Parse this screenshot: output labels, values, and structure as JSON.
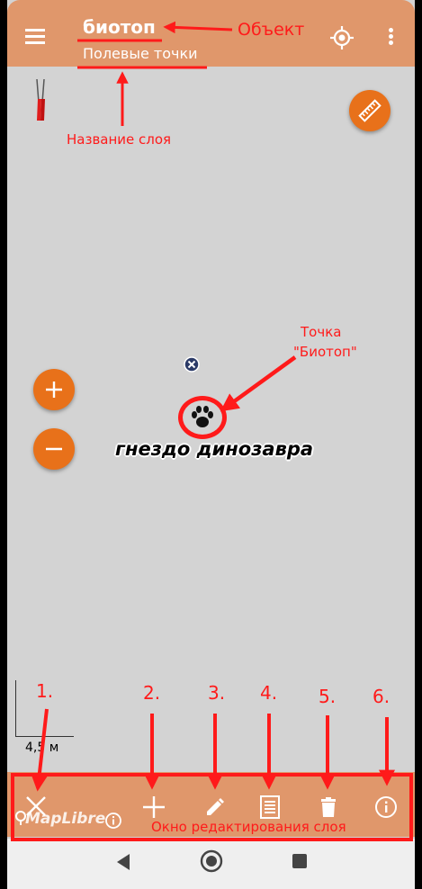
{
  "header": {
    "title": "биотоп",
    "subtitle": "Полевые точки"
  },
  "annotations": {
    "object": "Объект",
    "layer_name": "Название слоя",
    "point_line1": "Точка",
    "point_line2": "\"Биотоп\"",
    "edit_window": "Окно редактирования слоя",
    "n1": "1.",
    "n2": "2.",
    "n3": "3.",
    "n4": "4.",
    "n5": "5.",
    "n6": "6."
  },
  "map": {
    "feature_label": "гнездо динозавра",
    "scale_label": "4,5 м",
    "attribution": "MapLibre"
  },
  "icons": {
    "menu": "menu-icon",
    "locate": "crosshair-icon",
    "overflow": "more-vert-icon",
    "ruler": "ruler-icon",
    "compass": "compass-icon",
    "marker": "paw-icon",
    "close": "close-icon",
    "add": "plus-icon",
    "edit": "pencil-icon",
    "table": "list-icon",
    "delete": "trash-icon",
    "info": "info-icon"
  },
  "colors": {
    "bar": "#e0976b",
    "fab": "#e8711a",
    "annotation": "#ff1a1a",
    "map": "#d3d3d3"
  }
}
